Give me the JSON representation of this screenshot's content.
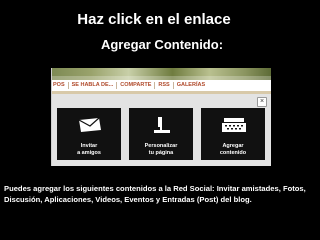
{
  "slide": {
    "title_line1": "Haz click en el enlace",
    "title_line2": "Agregar Contenido:",
    "caption": "Puedes agregar los siguientes contenidos a la Red Social: Invitar amistades, Fotos, Discusión, Aplicaciones, Videos, Eventos y Entradas (Post) del blog."
  },
  "screenshot": {
    "nav_items": [
      "POS",
      "SE HABLA DE...",
      "COMPARTE",
      "RSS",
      "GALERÍAS"
    ],
    "close_label": "×",
    "tiles": [
      {
        "line1": "Invitar",
        "line2": "a amigos",
        "icon": "envelope-icon"
      },
      {
        "line1": "Personalizar",
        "line2": "tu página",
        "icon": "paint-roller-icon"
      },
      {
        "line1": "Agregar",
        "line2": "contenido",
        "icon": "typewriter-icon"
      }
    ],
    "colors": {
      "nav_text": "#b04a2b",
      "tile_bg": "#111111",
      "panel_bg": "#e3e3e3"
    }
  }
}
